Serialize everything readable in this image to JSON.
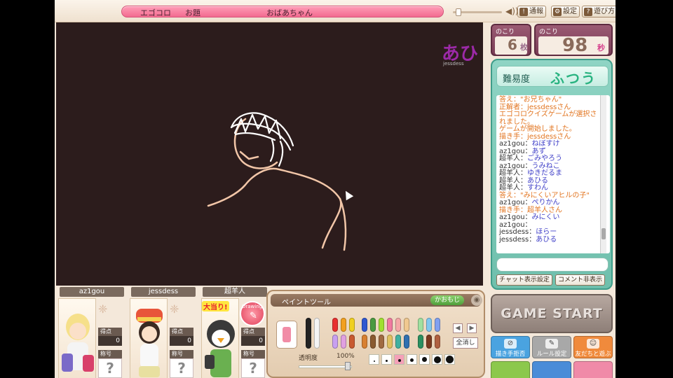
{
  "topic": {
    "app": "エゴコロ",
    "label": "お題",
    "word": "おばあちゃん"
  },
  "topbuttons": [
    "通報",
    "設定",
    "遊び方"
  ],
  "counters": {
    "cards": {
      "label": "のこり",
      "value": "6",
      "unit": "枚"
    },
    "time": {
      "label": "のこり",
      "value": "98",
      "unit": "秒"
    }
  },
  "drawer": {
    "badge": "あひ",
    "name": "jessdess"
  },
  "difficulty": {
    "label": "難易度",
    "value": "ふつう"
  },
  "chat": {
    "lines": [
      {
        "type": "sys",
        "text": "答え：\"お兄ちゃん\""
      },
      {
        "type": "sys",
        "text": "正解者：jessdessさん"
      },
      {
        "type": "sys",
        "text": "エゴコロクイズゲームが選択されました。"
      },
      {
        "type": "sys",
        "text": "ゲームが開始しました。"
      },
      {
        "type": "sys",
        "text": "描き手：jessdessさん"
      },
      {
        "type": "msg",
        "user": "az1gou",
        "text": "ねぼすけ"
      },
      {
        "type": "msg",
        "user": "az1gou",
        "text": "あず"
      },
      {
        "type": "msg",
        "user": "超羊人",
        "text": "ごみやろう"
      },
      {
        "type": "msg",
        "user": "az1gou",
        "text": "うみねこ"
      },
      {
        "type": "msg",
        "user": "超羊人",
        "text": "ゆきだるま"
      },
      {
        "type": "msg",
        "user": "超羊人",
        "text": "あひる"
      },
      {
        "type": "msg",
        "user": "超羊人",
        "text": "すわん"
      },
      {
        "type": "sys",
        "text": "答え：\"みにくいアヒルの子\""
      },
      {
        "type": "msg",
        "user": "az1gou",
        "text": "ぺりかん"
      },
      {
        "type": "sys",
        "text": "描き手：超羊人さん"
      },
      {
        "type": "msg",
        "user": "az1gou",
        "text": "みにくい"
      },
      {
        "type": "msg",
        "user": "az1gou",
        "text": ""
      },
      {
        "type": "msg",
        "user": "jessdess",
        "text": "ほらー"
      },
      {
        "type": "msg",
        "user": "jessdess",
        "text": "あひる"
      }
    ],
    "settings_button": "チャット表示設定",
    "hide_button": "コメント非表示"
  },
  "game_start": "GAME START",
  "side_buttons": [
    {
      "label": "描き手拒否",
      "color": "#4aa3e0"
    },
    {
      "label": "ルール設定",
      "color": "#a8a8a8"
    },
    {
      "label": "友だちと遊ぶ",
      "color": "#f08a3c"
    }
  ],
  "players": [
    {
      "name": "az1gou",
      "score_label": "得点",
      "score": "0",
      "title_label": "称号",
      "title": "?"
    },
    {
      "name": "jessdess",
      "score_label": "得点",
      "score": "0",
      "title_label": "称号",
      "title": "?"
    },
    {
      "name": "超羊人",
      "score_label": "得点",
      "score": "0",
      "title_label": "称号",
      "title": "?",
      "badge": "大当り!",
      "drawing_badge": "Drawing"
    }
  ],
  "paint": {
    "title": "ペイントツール",
    "kaomoji": "かおもじ",
    "clear": "全消し",
    "opacity_label": "透明度",
    "opacity_value": "100%",
    "colors": [
      "#222222",
      "#f4f4f4",
      "#e83030",
      "#f2a020",
      "#f0d020",
      "#3058d0",
      "#4a9a40",
      "#9fe030",
      "#f07aa0",
      "#f5a8a8",
      "#f0c890",
      "#a0e0a0",
      "#80c8f0",
      "#80a0f0",
      "#c8a0f0",
      "#e0a0e0",
      "#c85a30",
      "#d88030",
      "#8a5a30",
      "#a06a40",
      "#e0c060",
      "#40b0a0",
      "#3070b0",
      "#2a9060",
      "#7a3a20",
      "#b06040",
      "#704020",
      "#c09060",
      "#b0d030",
      "#30a0a0",
      "#2050a0",
      "#206040"
    ]
  }
}
